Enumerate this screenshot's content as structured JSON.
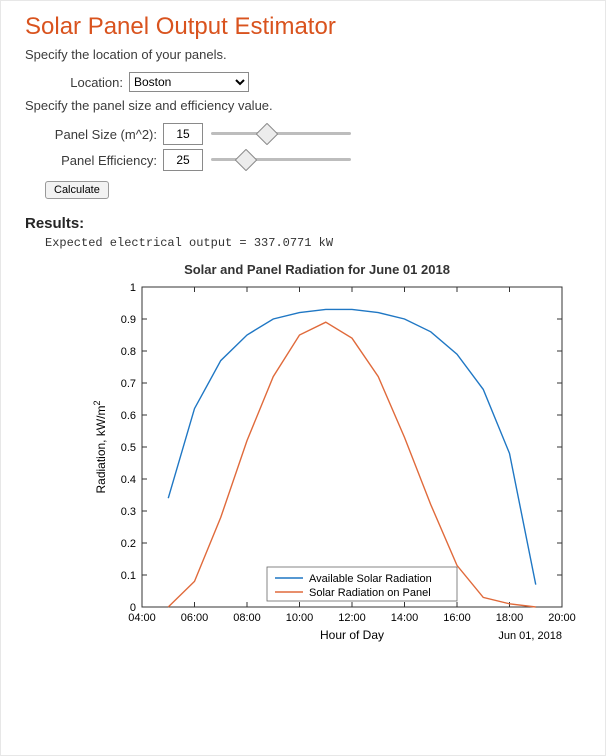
{
  "title": "Solar Panel Output Estimator",
  "prompt_location": "Specify the location of your panels.",
  "prompt_panel": "Specify the panel size and efficiency value.",
  "location": {
    "label": "Location:",
    "value": "Boston"
  },
  "panel_size": {
    "label": "Panel Size (m^2):",
    "value": "15",
    "slider_pct": 40
  },
  "panel_efficiency": {
    "label": "Panel Efficiency:",
    "value": "25",
    "slider_pct": 25
  },
  "calculate_label": "Calculate",
  "results_heading": "Results:",
  "output_text": "Expected electrical output = 337.0771 kW",
  "chart_data": {
    "type": "line",
    "title": "Solar and Panel Radiation for June 01 2018",
    "xlabel": "Hour of Day",
    "ylabel": "Radiation, kW/m",
    "ylabel_super": "2",
    "xlim": [
      4,
      20
    ],
    "ylim": [
      0,
      1
    ],
    "x_ticks": [
      "04:00",
      "06:00",
      "08:00",
      "10:00",
      "12:00",
      "14:00",
      "16:00",
      "18:00",
      "20:00"
    ],
    "y_ticks": [
      0,
      0.1,
      0.2,
      0.3,
      0.4,
      0.5,
      0.6,
      0.7,
      0.8,
      0.9,
      1
    ],
    "corner_label": "Jun 01, 2018",
    "series": [
      {
        "name": "Available Solar Radiation",
        "color": "#1f77c4",
        "x": [
          5,
          6,
          7,
          8,
          9,
          10,
          11,
          12,
          13,
          14,
          15,
          16,
          17,
          18,
          19
        ],
        "y": [
          0.34,
          0.62,
          0.77,
          0.85,
          0.9,
          0.92,
          0.93,
          0.93,
          0.92,
          0.9,
          0.86,
          0.79,
          0.68,
          0.48,
          0.07
        ]
      },
      {
        "name": "Solar Radiation on Panel",
        "color": "#e06a3b",
        "x": [
          5,
          6,
          7,
          8,
          9,
          10,
          11,
          12,
          13,
          14,
          15,
          16,
          17,
          18,
          19
        ],
        "y": [
          0.0,
          0.08,
          0.28,
          0.52,
          0.72,
          0.85,
          0.89,
          0.84,
          0.72,
          0.53,
          0.32,
          0.13,
          0.03,
          0.01,
          0.0
        ]
      }
    ]
  }
}
